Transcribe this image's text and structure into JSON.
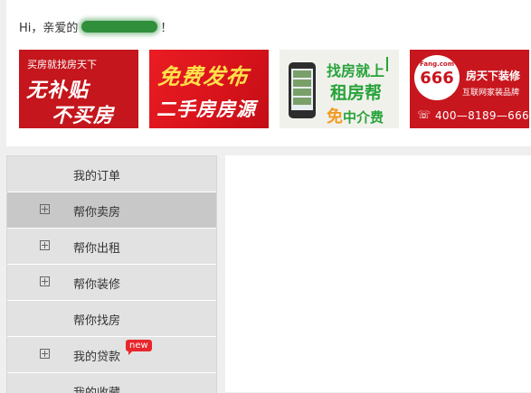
{
  "header": {
    "greeting_prefix": "Hi，亲爱的",
    "greeting_suffix": "！"
  },
  "banners": [
    {
      "small": "买房就找房天下",
      "line1": "无补贴",
      "line2": "不买房"
    },
    {
      "line1": "免费发布",
      "line2": "二手房房源"
    },
    {
      "line1": "找房就上",
      "line2": "租房帮",
      "line3_hl": "免",
      "line3": "中介费"
    },
    {
      "logo_small": "Fang.com",
      "logo_num": "666",
      "brand": "房天下装修",
      "slogan": "互联网家装品牌",
      "phone": "400—8189—666"
    }
  ],
  "menu": {
    "items": [
      {
        "label": "我的订单"
      },
      {
        "label": "帮你卖房"
      },
      {
        "label": "帮你出租"
      },
      {
        "label": "帮你装修"
      },
      {
        "label": "帮你找房"
      },
      {
        "label": "我的贷款",
        "badge": "new"
      },
      {
        "label": "我的收藏"
      }
    ]
  },
  "colors": {
    "menu_bg": "#e2e2e2",
    "menu_active_bg": "#c8c8c8",
    "badge_red": "#e8262c",
    "banner_red": "#c4161c",
    "banner_green": "#27a33a"
  }
}
